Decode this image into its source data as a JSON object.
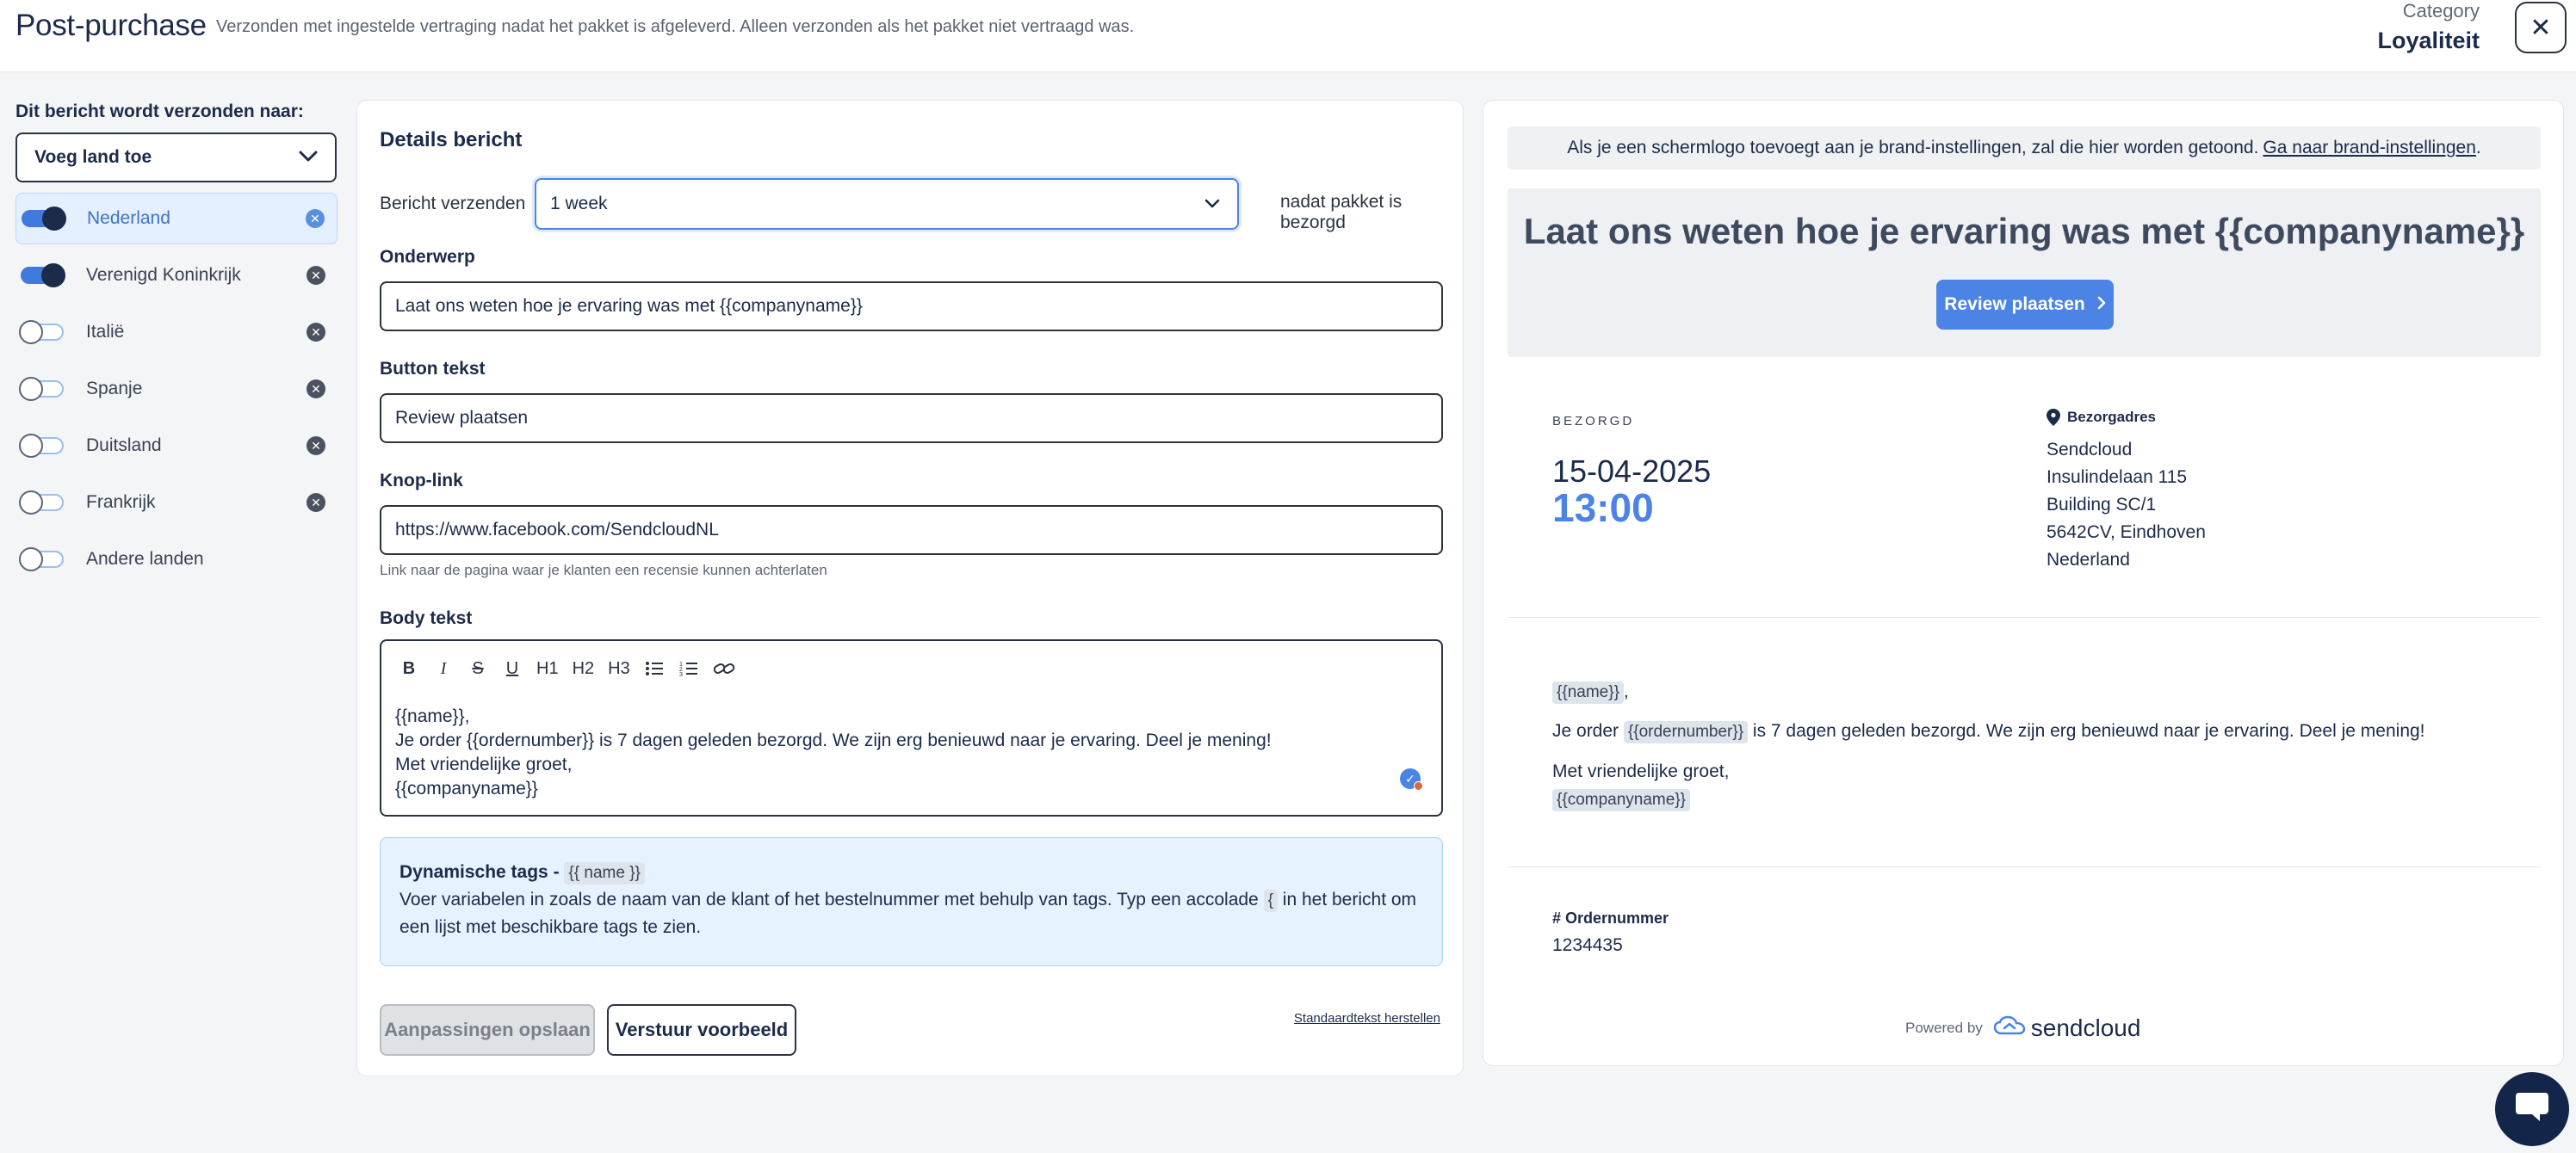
{
  "header": {
    "title": "Post-purchase",
    "description": "Verzonden met ingestelde vertraging nadat het pakket is afgeleverd. Alleen verzonden als het pakket niet vertraagd was.",
    "category_label": "Category",
    "category_value": "Loyaliteit",
    "close_icon": "✕"
  },
  "sidebar": {
    "heading": "Dit bericht wordt verzonden naar:",
    "dropdown_label": "Voeg land toe",
    "countries": [
      {
        "name": "Nederland",
        "enabled": true,
        "active": true,
        "removable": true
      },
      {
        "name": "Verenigd Koninkrijk",
        "enabled": true,
        "active": false,
        "removable": true
      },
      {
        "name": "Italië",
        "enabled": false,
        "active": false,
        "removable": true
      },
      {
        "name": "Spanje",
        "enabled": false,
        "active": false,
        "removable": true
      },
      {
        "name": "Duitsland",
        "enabled": false,
        "active": false,
        "removable": true
      },
      {
        "name": "Frankrijk",
        "enabled": false,
        "active": false,
        "removable": true
      },
      {
        "name": "Andere landen",
        "enabled": false,
        "active": false,
        "removable": false
      }
    ]
  },
  "form": {
    "section_title": "Details bericht",
    "send_label": "Bericht verzenden",
    "delay_value": "1 week",
    "send_after": "nadat pakket is bezorgd",
    "subject_label": "Onderwerp",
    "subject_value": "Laat ons weten hoe je ervaring was met {{companyname}}",
    "button_text_label": "Button tekst",
    "button_text_value": "Review plaatsen",
    "link_label": "Knop-link",
    "link_value": "https://www.facebook.com/SendcloudNL",
    "link_hint": "Link naar de pagina waar je klanten een recensie kunnen achterlaten",
    "body_label": "Body tekst",
    "toolbar": {
      "bold": "B",
      "italic": "I",
      "strike": "S",
      "underline": "U",
      "h1": "H1",
      "h2": "H2",
      "h3": "H3"
    },
    "body_lines": [
      "{{name}},",
      "Je order {{ordernumber}} is 7 dagen geleden bezorgd. We zijn erg benieuwd naar je ervaring. Deel je mening!",
      "Met vriendelijke groet,",
      "{{companyname}}"
    ],
    "tags_title": "Dynamische tags -",
    "tags_chip": "{{ name }}",
    "tags_text_1": "Voer variabelen in zoals de naam van de klant of het bestelnummer met behulp van tags. Typ een accolade",
    "tags_brace": "{",
    "tags_text_2": "in het bericht om een lijst met beschikbare tags te zien.",
    "save_label": "Aanpassingen opslaan",
    "preview_label": "Verstuur voorbeeld",
    "reset_label": "Standaardtekst herstellen"
  },
  "preview": {
    "brand_note": "Als je een schermlogo toevoegt aan je brand-instellingen, zal die hier worden getoond.",
    "brand_link": "Ga naar brand-instellingen",
    "brand_note_end": ".",
    "hero_title": "Laat ons weten hoe je ervaring was met {{companyname}}",
    "hero_button": "Review plaatsen",
    "delivered_label": "BEZORGD",
    "delivered_date": "15-04-2025",
    "delivered_time": "13:00",
    "address_title": "Bezorgadres",
    "address_lines": [
      "Sendcloud",
      "Insulindelaan 115",
      "Building SC/1",
      "5642CV, Eindhoven",
      "Nederland"
    ],
    "msg_name": "{{name}}",
    "msg_comma": ",",
    "msg_order_prefix": "Je order",
    "msg_order_tag": "{{ordernumber}}",
    "msg_order_suffix": "is 7 dagen geleden bezorgd. We zijn erg benieuwd naar je ervaring. Deel je mening!",
    "msg_greeting": "Met vriendelijke groet,",
    "msg_company": "{{companyname}}",
    "order_label": "# Ordernummer",
    "order_value": "1234435",
    "powered_by": "Powered by",
    "brand_name": "sendcloud"
  },
  "colors": {
    "accent": "#4b84e4",
    "navy": "#1c2b4a",
    "tag_box_bg": "#e6f2ff"
  }
}
